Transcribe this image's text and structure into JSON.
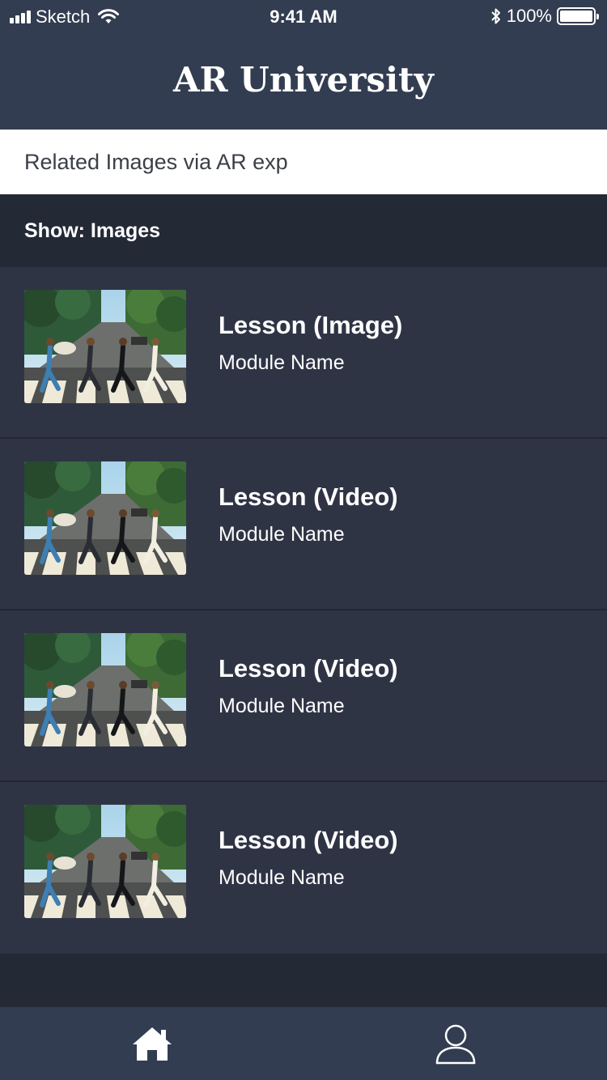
{
  "status_bar": {
    "carrier": "Sketch",
    "time": "9:41 AM",
    "battery_percent": "100%",
    "battery_level": 1.0,
    "icons": [
      "signal-icon",
      "wifi-icon",
      "bluetooth-icon",
      "battery-icon"
    ]
  },
  "header": {
    "title": "AR University"
  },
  "context": {
    "label": "Related Images via AR exp"
  },
  "filter": {
    "label": "Show: Images"
  },
  "lessons": [
    {
      "title": "Lesson (Image)",
      "subtitle": "Module Name"
    },
    {
      "title": "Lesson (Video)",
      "subtitle": "Module Name"
    },
    {
      "title": "Lesson (Video)",
      "subtitle": "Module Name"
    },
    {
      "title": "Lesson (Video)",
      "subtitle": "Module Name"
    }
  ],
  "tab_bar": {
    "tabs": [
      {
        "icon": "home-icon",
        "active": true
      },
      {
        "icon": "profile-icon",
        "active": false
      }
    ]
  },
  "colors": {
    "nav_background": "#333d51",
    "list_background": "#2f3445",
    "page_background": "#242936",
    "context_background": "#ffffff"
  }
}
